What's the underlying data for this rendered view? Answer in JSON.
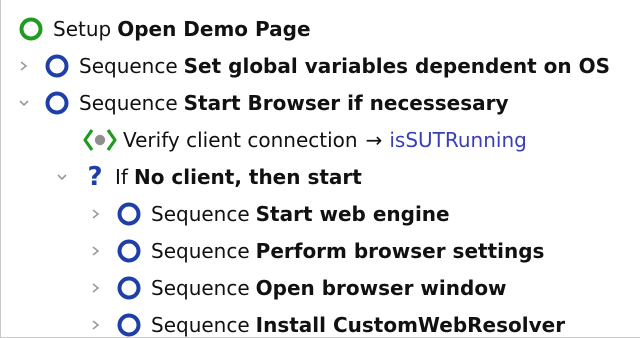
{
  "tree": {
    "rows": [
      {
        "keyword": "Setup",
        "name": "Open Demo Page"
      },
      {
        "keyword": "Sequence",
        "name": "Set global variables dependent on OS"
      },
      {
        "keyword": "Sequence",
        "name": "Start Browser if necessesary"
      },
      {
        "keyword": "Verify client connection",
        "arrow": "→",
        "target": "isSUTRunning"
      },
      {
        "keyword": "If",
        "name": "No client, then start"
      },
      {
        "keyword": "Sequence",
        "name": "Start web engine"
      },
      {
        "keyword": "Sequence",
        "name": "Perform browser settings"
      },
      {
        "keyword": "Sequence",
        "name": "Open browser window"
      },
      {
        "keyword": "Sequence",
        "name": "Install CustomWebResolver"
      }
    ]
  },
  "icons": {
    "setup": "green-ring-icon",
    "sequence": "blue-ring-icon",
    "verify": "green-diamond-check-icon",
    "condition": "question-mark-icon",
    "expanded": "chevron-down-icon",
    "collapsed": "chevron-right-icon"
  },
  "colors": {
    "setup_green": "#1f9b1f",
    "sequence_blue": "#1f3fa8",
    "link_blue": "#3a3fb5",
    "chevron_gray": "#9a9a9a"
  }
}
